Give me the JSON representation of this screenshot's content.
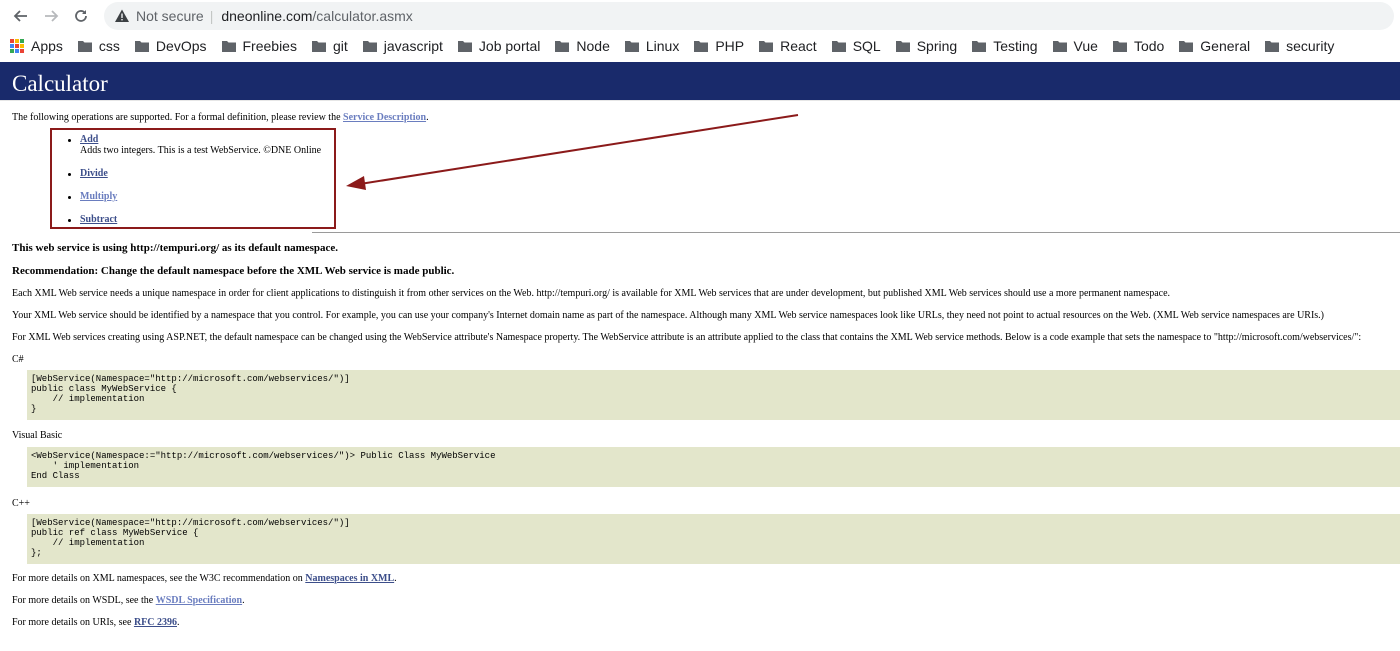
{
  "browser": {
    "security_label": "Not secure",
    "url_domain": "dneonline.com",
    "url_path": "/calculator.asmx",
    "bookmarks": [
      "Apps",
      "css",
      "DevOps",
      "Freebies",
      "git",
      "javascript",
      "Job portal",
      "Node",
      "Linux",
      "PHP",
      "React",
      "SQL",
      "Spring",
      "Testing",
      "Vue",
      "Todo",
      "General",
      "security"
    ]
  },
  "page": {
    "title": "Calculator",
    "intro_text": "The following operations are supported. For a formal definition, please review the ",
    "service_description_link": "Service Description",
    "intro_end": ".",
    "operations": [
      {
        "name": "Add",
        "description": "Adds two integers. This is a test WebService. ©DNE Online"
      },
      {
        "name": "Divide",
        "description": ""
      },
      {
        "name": "Multiply",
        "description": ""
      },
      {
        "name": "Subtract",
        "description": ""
      }
    ],
    "namespace_notice": "This web service is using http://tempuri.org/ as its default namespace.",
    "recommendation": "Recommendation: Change the default namespace before the XML Web service is made public.",
    "para1": "Each XML Web service needs a unique namespace in order for client applications to distinguish it from other services on the Web. http://tempuri.org/ is available for XML Web services that are under development, but published XML Web services should use a more permanent namespace.",
    "para2": "Your XML Web service should be identified by a namespace that you control. For example, you can use your company's Internet domain name as part of the namespace. Although many XML Web service namespaces look like URLs, they need not point to actual resources on the Web. (XML Web service namespaces are URIs.)",
    "para3": "For XML Web services creating using ASP.NET, the default namespace can be changed using the WebService attribute's Namespace property. The WebService attribute is an attribute applied to the class that contains the XML Web service methods. Below is a code example that sets the namespace to \"http://microsoft.com/webservices/\":",
    "code_examples": [
      {
        "language": "C#",
        "code": "[WebService(Namespace=\"http://microsoft.com/webservices/\")]\npublic class MyWebService {\n    // implementation\n}"
      },
      {
        "language": "Visual Basic",
        "code": "<WebService(Namespace:=\"http://microsoft.com/webservices/\")> Public Class MyWebService\n    ' implementation\nEnd Class"
      },
      {
        "language": "C++",
        "code": "[WebService(Namespace=\"http://microsoft.com/webservices/\")]\npublic ref class MyWebService {\n    // implementation\n};"
      }
    ],
    "more_xml_prefix": "For more details on XML namespaces, see the W3C recommendation on ",
    "more_xml_link": "Namespaces in XML",
    "more_wsdl_prefix": "For more details on WSDL, see the ",
    "more_wsdl_link": "WSDL Specification",
    "more_uri_prefix": "For more details on URIs, see ",
    "more_uri_link": "RFC 2396",
    "period": "."
  },
  "colors": {
    "header_bg": "#192a6b",
    "code_bg": "#e3e6cb",
    "highlight_border": "#8b1a1a",
    "link": "#3c4e8a"
  }
}
